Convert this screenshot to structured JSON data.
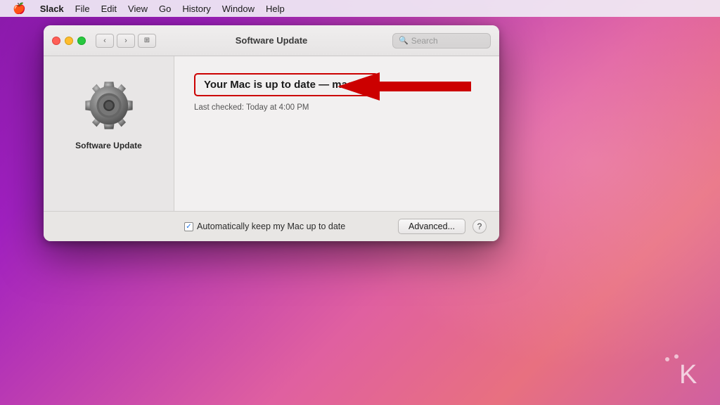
{
  "menubar": {
    "apple": "🍎",
    "app_name": "Slack",
    "items": [
      "File",
      "Edit",
      "View",
      "Go",
      "History",
      "Window",
      "Help"
    ]
  },
  "window": {
    "title": "Software Update",
    "search_placeholder": "Search"
  },
  "sidebar": {
    "label": "Software Update"
  },
  "main": {
    "status_title": "Your Mac is up to date — macOS",
    "last_checked": "Last checked: Today at 4:00 PM"
  },
  "bottom": {
    "checkbox_checked": "✓",
    "checkbox_label": "Automatically keep my Mac up to date",
    "advanced_button": "Advanced...",
    "help_button": "?"
  },
  "arrow": {
    "color": "#cc0000"
  }
}
